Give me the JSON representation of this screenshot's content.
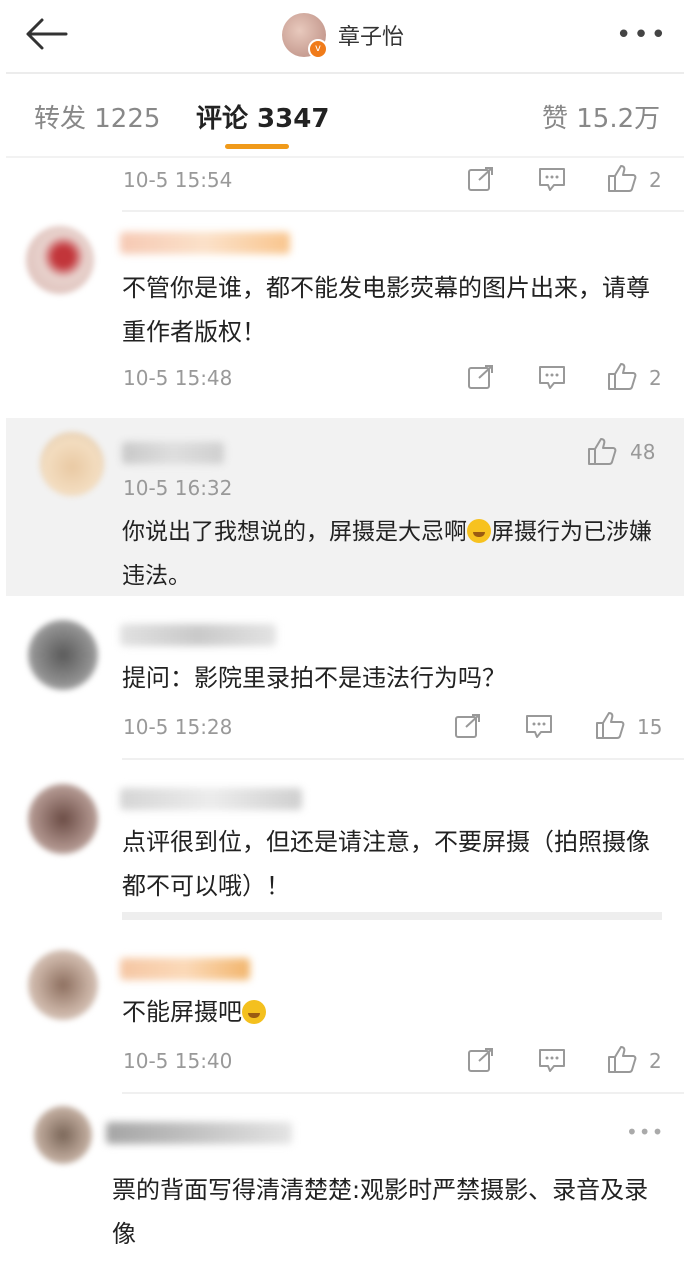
{
  "header": {
    "title": "章子怡",
    "more_label": "•••"
  },
  "tabs": [
    {
      "label": "转发 1225"
    },
    {
      "label": "评论 3347"
    },
    {
      "label": "赞 15.2万"
    }
  ],
  "comments": [
    {
      "time": "10-5 15:54",
      "likes": "2"
    },
    {
      "text": "不管你是谁，都不能发电影荧幕的图片出来，请尊重作者版权！",
      "time": "10-5 15:48",
      "likes": "2"
    },
    {
      "text_before": "你说出了我想说的，屏摄是大忌啊",
      "text_after": "屏摄行为已涉嫌违法。",
      "time": "10-5 16:32",
      "likes": "48"
    },
    {
      "text": "提问：影院里录拍不是违法行为吗？",
      "time": "10-5 15:28",
      "likes": "15"
    },
    {
      "text": "点评很到位，但还是请注意，不要屏摄（拍照摄像都不可以哦）！"
    },
    {
      "text": "不能屏摄吧",
      "time": "10-5 15:40",
      "likes": "2"
    },
    {
      "text": "票的背面写得清清楚楚:观影时严禁摄影、录音及录像",
      "more_label": "•••"
    }
  ],
  "colors": {
    "accent": "#f09a1a",
    "verified": "#f07b1a"
  }
}
